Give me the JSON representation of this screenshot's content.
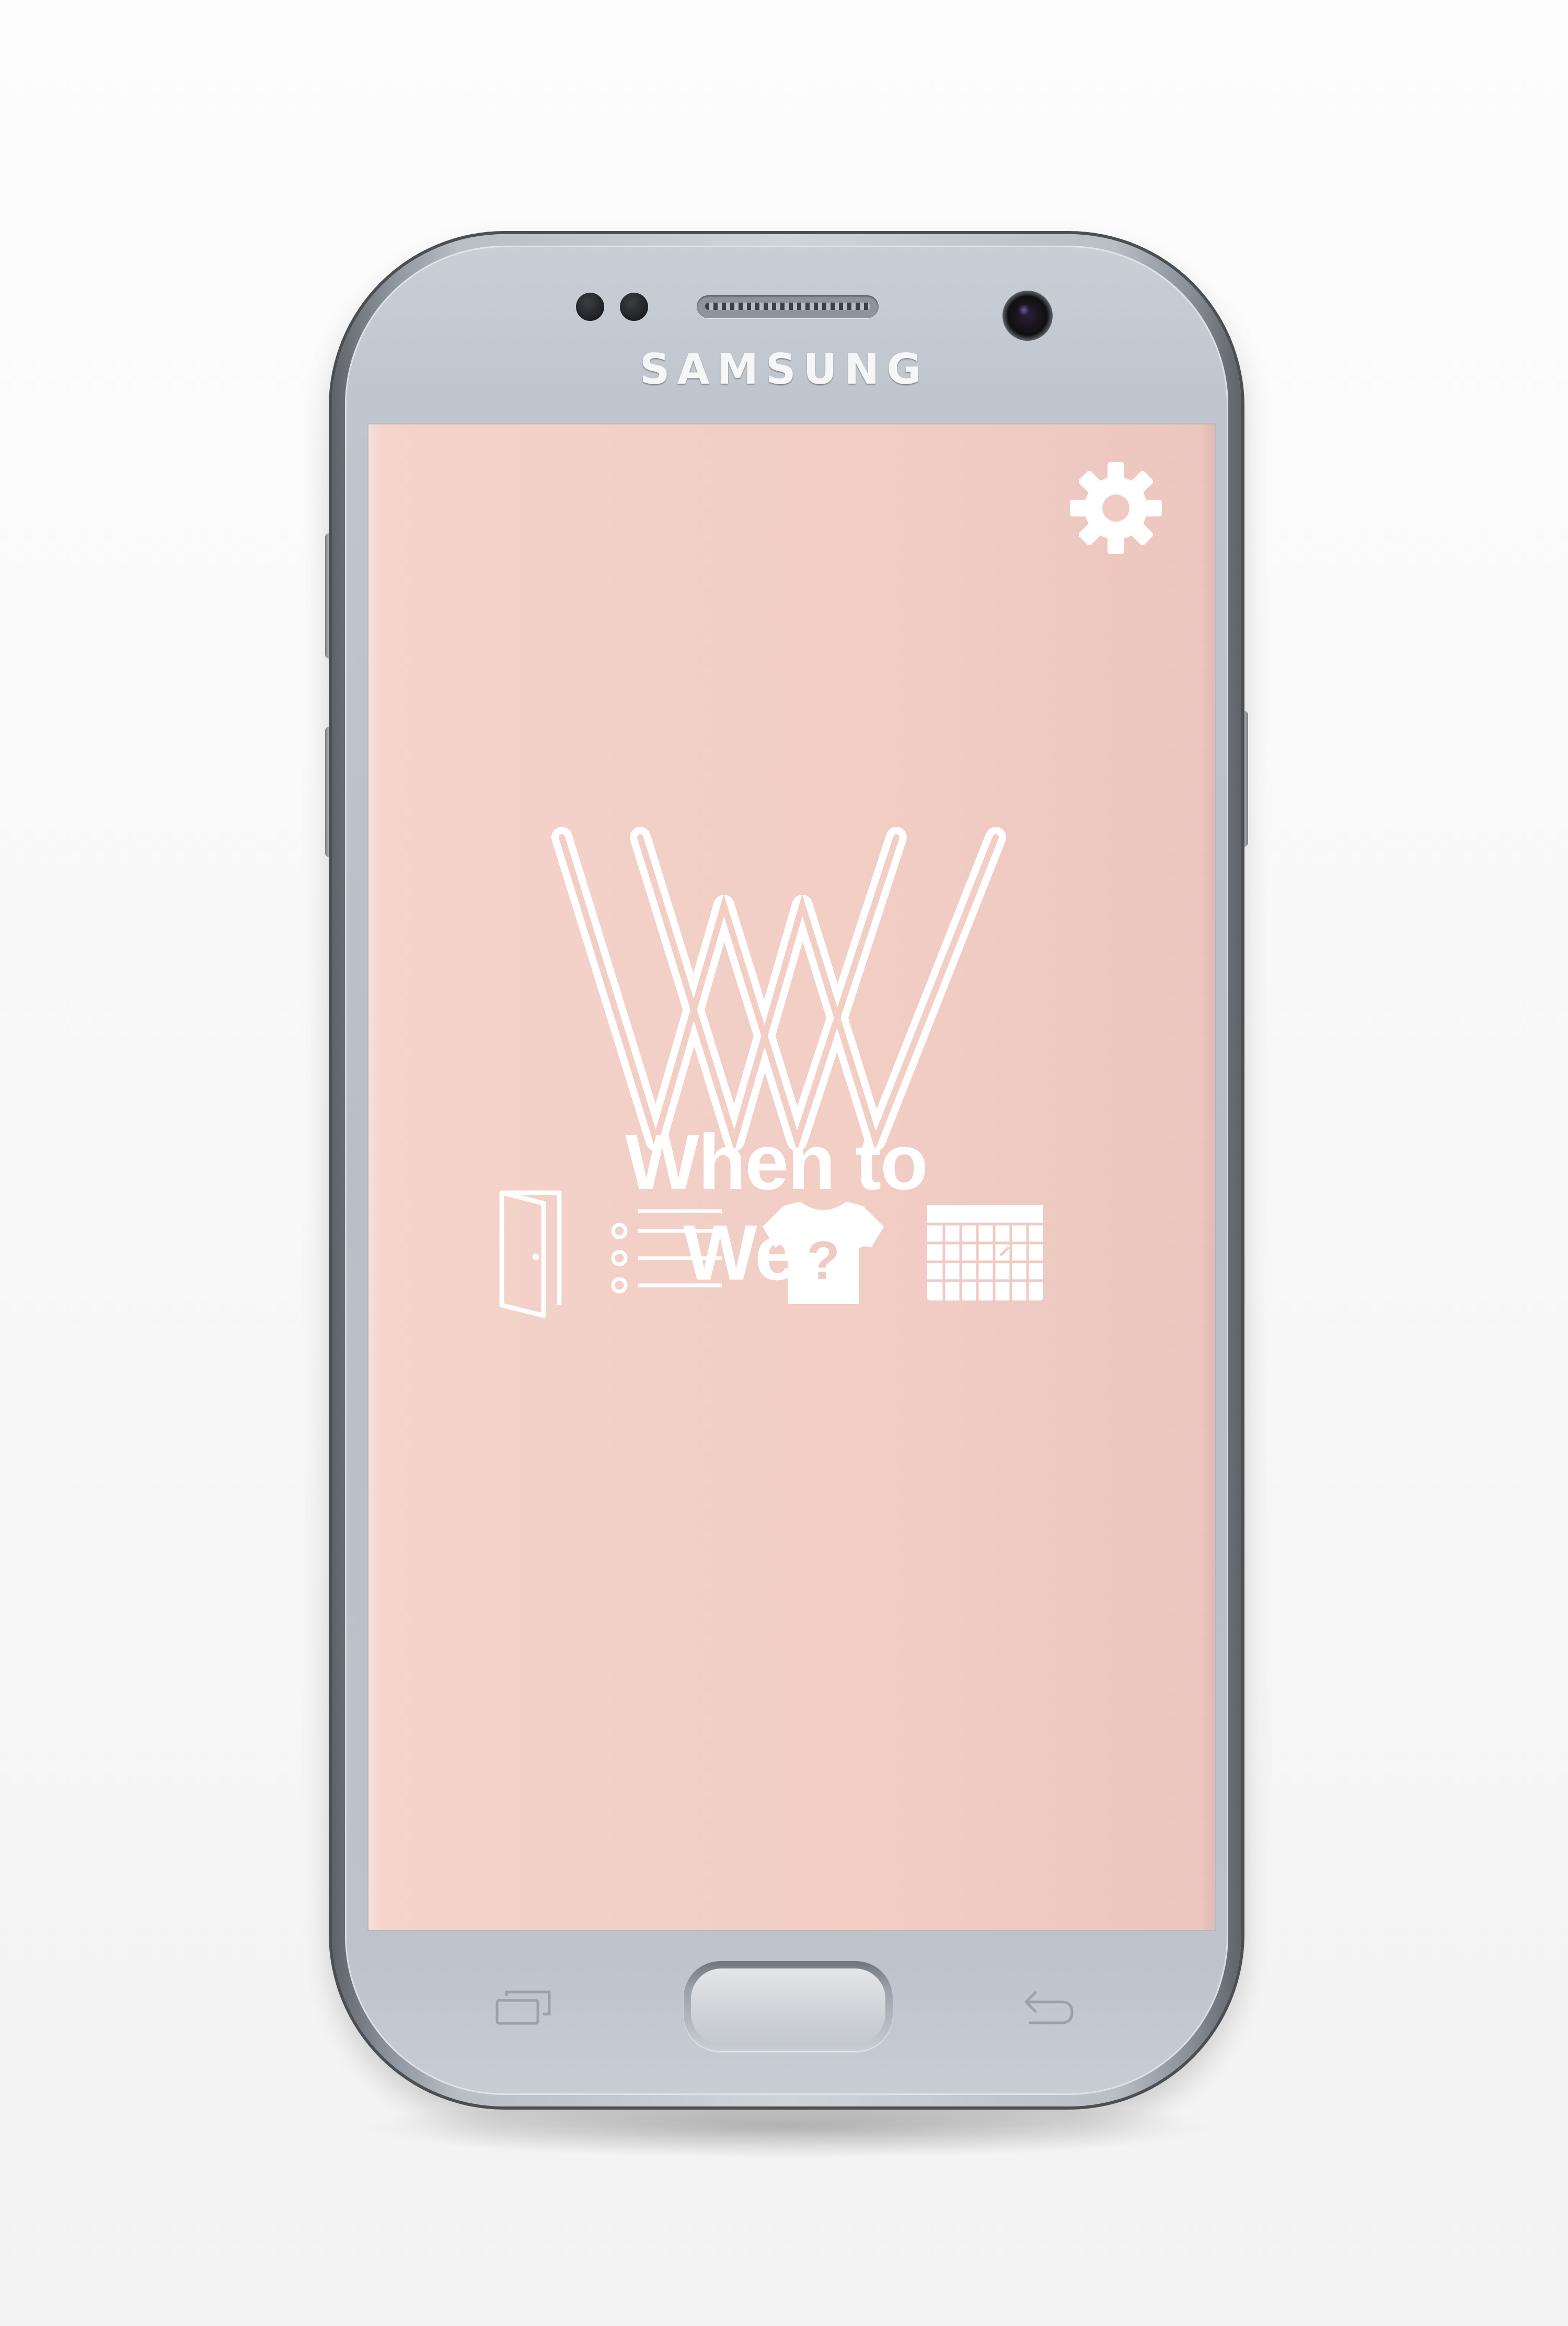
{
  "device": {
    "brand_label": "SAMSUNG"
  },
  "app": {
    "name": "When to Wear",
    "logo_icon": "w-monogram-logo",
    "colors": {
      "background": "#f2cec5",
      "foreground": "#ffffff"
    }
  },
  "header": {
    "settings_icon": "gear-icon"
  },
  "bottom_nav": {
    "items": [
      {
        "icon": "door-icon"
      },
      {
        "icon": "list-icon"
      },
      {
        "icon": "shirt-question-icon"
      },
      {
        "icon": "calendar-icon"
      }
    ]
  },
  "system_keys": {
    "recent_icon": "recent-apps-icon",
    "home_icon": "home-key",
    "back_icon": "back-arrow-icon"
  }
}
